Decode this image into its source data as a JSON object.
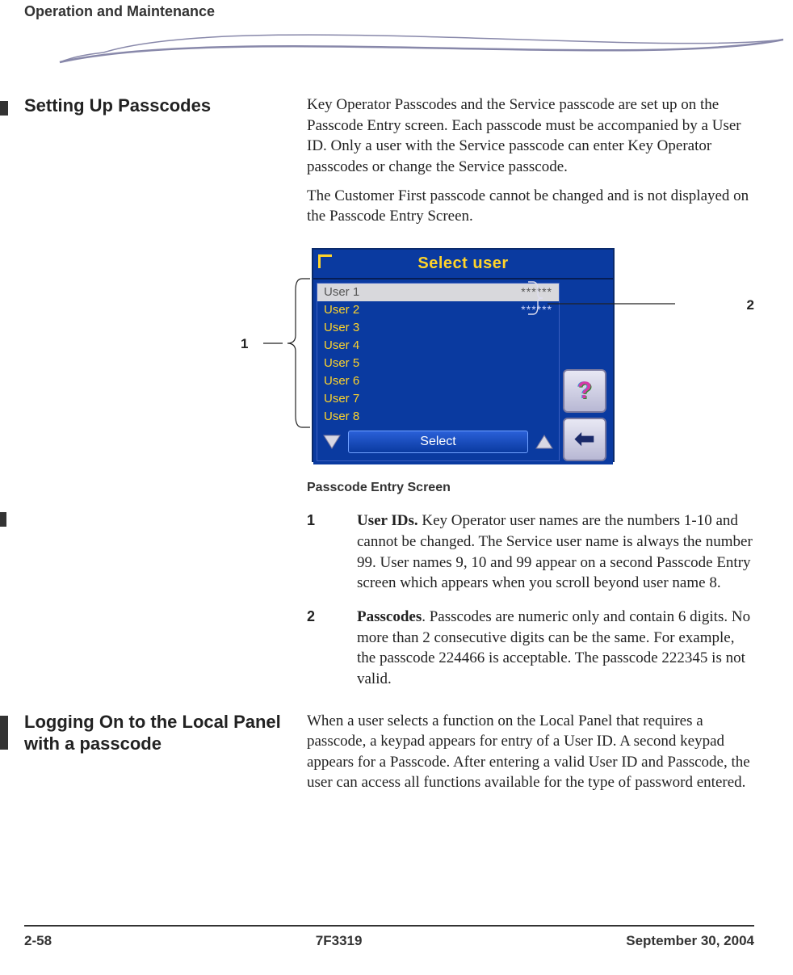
{
  "header": {
    "chapter": "Operation and Maintenance"
  },
  "sections": {
    "settingUp": {
      "title": "Setting Up Passcodes",
      "para1": " Key Operator Passcodes and the Service passcode are set up on the Passcode Entry screen. Each passcode must be accompanied by a User ID. Only a user with the Service passcode can enter Key Operator passcodes or change the Service passcode.",
      "para2": "The Customer First passcode cannot be changed and is not displayed on the Passcode Entry Screen."
    },
    "loggingOn": {
      "title": "Logging On to the Local Panel with a passcode",
      "para1": " When a user selects a function on the Local Panel that requires a passcode, a keypad appears for entry of a User ID. A second keypad appears for a Passcode. After entering a valid User ID and Passcode, the user can access all functions available for the type of password entered."
    }
  },
  "screenshot": {
    "title": "Select user",
    "users": [
      {
        "name": "User 1",
        "pass": "******",
        "selected": true
      },
      {
        "name": "User 2",
        "pass": "******",
        "selected": false
      },
      {
        "name": "User 3",
        "pass": "",
        "selected": false
      },
      {
        "name": "User 4",
        "pass": "",
        "selected": false
      },
      {
        "name": "User 5",
        "pass": "",
        "selected": false
      },
      {
        "name": "User 6",
        "pass": "",
        "selected": false
      },
      {
        "name": "User 7",
        "pass": "",
        "selected": false
      },
      {
        "name": "User 8",
        "pass": "",
        "selected": false
      }
    ],
    "selectLabel": "Select",
    "caption": "Passcode Entry Screen"
  },
  "callouts": {
    "c1": "1",
    "c2": "2"
  },
  "defs": [
    {
      "num": "1",
      "bold": "User IDs.",
      "text": " Key Operator user names are the numbers 1-10 and cannot be changed. The Service user name is always the number 99. User names 9, 10 and 99 appear on a second Passcode Entry screen which appears when you scroll beyond user name 8."
    },
    {
      "num": "2",
      "bold": "Passcodes",
      "text": ". Passcodes are numeric only and contain 6 digits. No more than 2 consecutive digits can be the same. For example, the passcode 224466 is acceptable. The passcode 222345 is not valid."
    }
  ],
  "footer": {
    "page": "2-58",
    "doc": "7F3319",
    "date": "September 30, 2004"
  }
}
